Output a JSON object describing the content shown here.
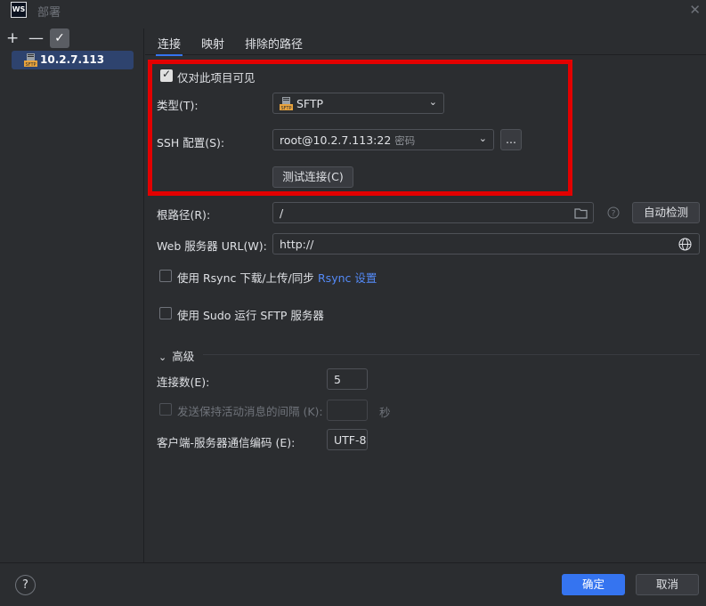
{
  "window": {
    "logo": "WS",
    "title": "部署",
    "close_icon": "✕"
  },
  "left": {
    "add": "+",
    "remove": "—",
    "apply": "✓",
    "server": {
      "label": "10.2.7.113",
      "icon": "sftp-server-icon"
    }
  },
  "tabs": [
    {
      "label": "连接"
    },
    {
      "label": "映射"
    },
    {
      "label": "排除的路径"
    }
  ],
  "form": {
    "visible_only_project": "仅对此项目可见",
    "type_label": "类型(T):",
    "type_value": "SFTP",
    "ssh_label": "SSH 配置(S):",
    "ssh_value": "root@10.2.7.113:22",
    "ssh_hint": "密码",
    "ellipsis": "...",
    "test_connection": "测试连接(C)",
    "root_label": "根路径(R):",
    "root_value": "/",
    "autodetect": "自动检测",
    "web_url_label": "Web 服务器 URL(W):",
    "web_url_value": "http://",
    "rsync_label": "使用 Rsync 下载/上传/同步",
    "rsync_link": "Rsync 设置",
    "sudo_label": "使用 Sudo 运行 SFTP 服务器"
  },
  "advanced": {
    "title": "高级",
    "connections_label": "连接数(E):",
    "connections_value": "5",
    "keepalive_label": "发送保持活动消息的间隔 (K):",
    "keepalive_value": "",
    "keepalive_unit": "秒",
    "encoding_label": "客户端-服务器通信编码 (E):",
    "encoding_value": "UTF-8"
  },
  "footer": {
    "help": "?",
    "ok": "确定",
    "cancel": "取消"
  },
  "colors": {
    "accent": "#3574f0",
    "highlight": "#e30000",
    "background": "#2b2d30"
  }
}
